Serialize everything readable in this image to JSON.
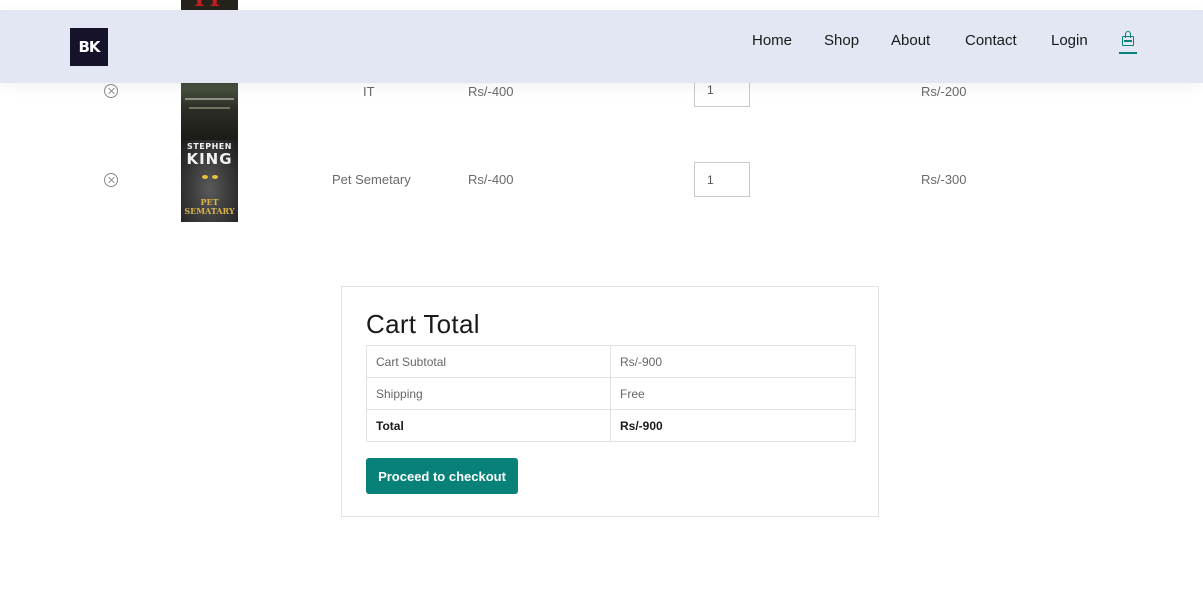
{
  "header": {
    "logo_text": "BK",
    "nav": [
      "Home",
      "Shop",
      "About",
      "Contact",
      "Login"
    ]
  },
  "cart": {
    "rows": [
      {
        "product": "IT",
        "price": "Rs/-400",
        "quantity": "1",
        "subtotal": "Rs/-200",
        "cover_text": "IT"
      },
      {
        "product": "Pet Semetary",
        "price": "Rs/-400",
        "quantity": "1",
        "subtotal": "Rs/-300",
        "cover_author_1": "STEPHEN",
        "cover_author_2": "KING",
        "cover_title": "PET SEMATARY"
      }
    ]
  },
  "cart_total": {
    "title": "Cart Total",
    "rows": [
      {
        "label": "Cart Subtotal",
        "value": "Rs/-900"
      },
      {
        "label": "Shipping",
        "value": "Free"
      },
      {
        "label": "Total",
        "value": "Rs/-900"
      }
    ],
    "checkout_label": "Proceed to checkout"
  },
  "colors": {
    "accent": "#088178",
    "header_bg": "#e3e6f3"
  },
  "icons": {
    "remove": "remove-circle-icon",
    "cart": "shopping-bag-icon"
  }
}
